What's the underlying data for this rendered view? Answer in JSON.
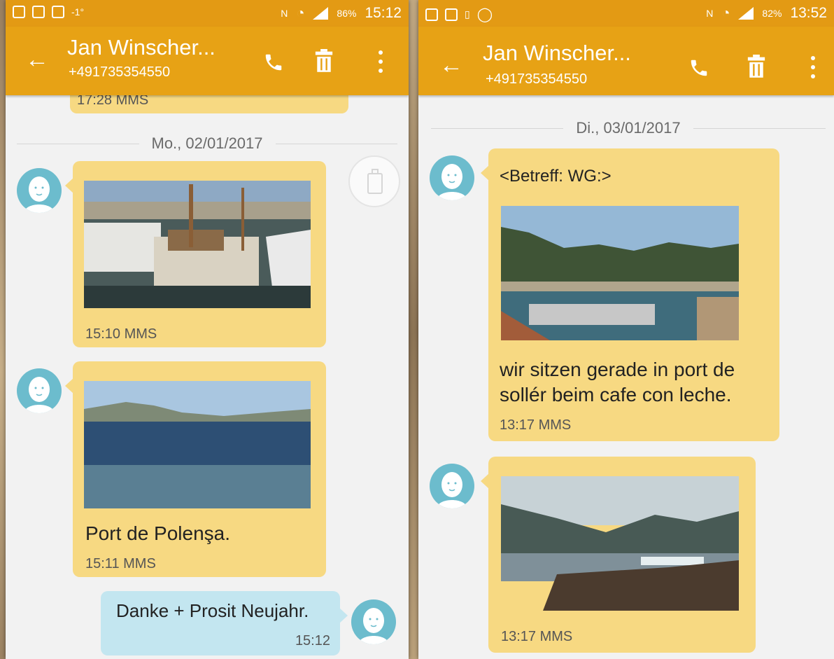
{
  "left": {
    "status": {
      "temp": "-1°",
      "battery": "86%",
      "time": "15:12"
    },
    "header": {
      "title": "Jan Winscher...",
      "number": "+491735354550"
    },
    "partial_meta": "17:28 MMS",
    "date_separator": "Mo., 02/01/2017",
    "messages": [
      {
        "meta": "15:10 MMS"
      },
      {
        "caption": "Port de Polenşa.",
        "meta": "15:11 MMS"
      },
      {
        "text": "Danke + Prosit Neujahr.",
        "time": "15:12"
      }
    ]
  },
  "right": {
    "status": {
      "battery": "82%",
      "time": "13:52"
    },
    "header": {
      "title": "Jan Winscher...",
      "number": "+491735354550"
    },
    "date_separator": "Di., 03/01/2017",
    "messages": [
      {
        "subject": "<Betreff: WG:>",
        "text_line1": "wir sitzen gerade in port de",
        "text_line2": "sollér beim cafe con leche.",
        "meta": "13:17 MMS"
      },
      {
        "meta": "13:17 MMS"
      }
    ]
  },
  "colors": {
    "accent": "#e7a215",
    "received_bubble": "#f7d982",
    "sent_bubble": "#c3e6f0",
    "avatar": "#6cbccd"
  },
  "icons": [
    "back-arrow-icon",
    "phone-icon",
    "trash-icon",
    "more-vert-icon",
    "contact-avatar-icon",
    "compose-icon"
  ]
}
